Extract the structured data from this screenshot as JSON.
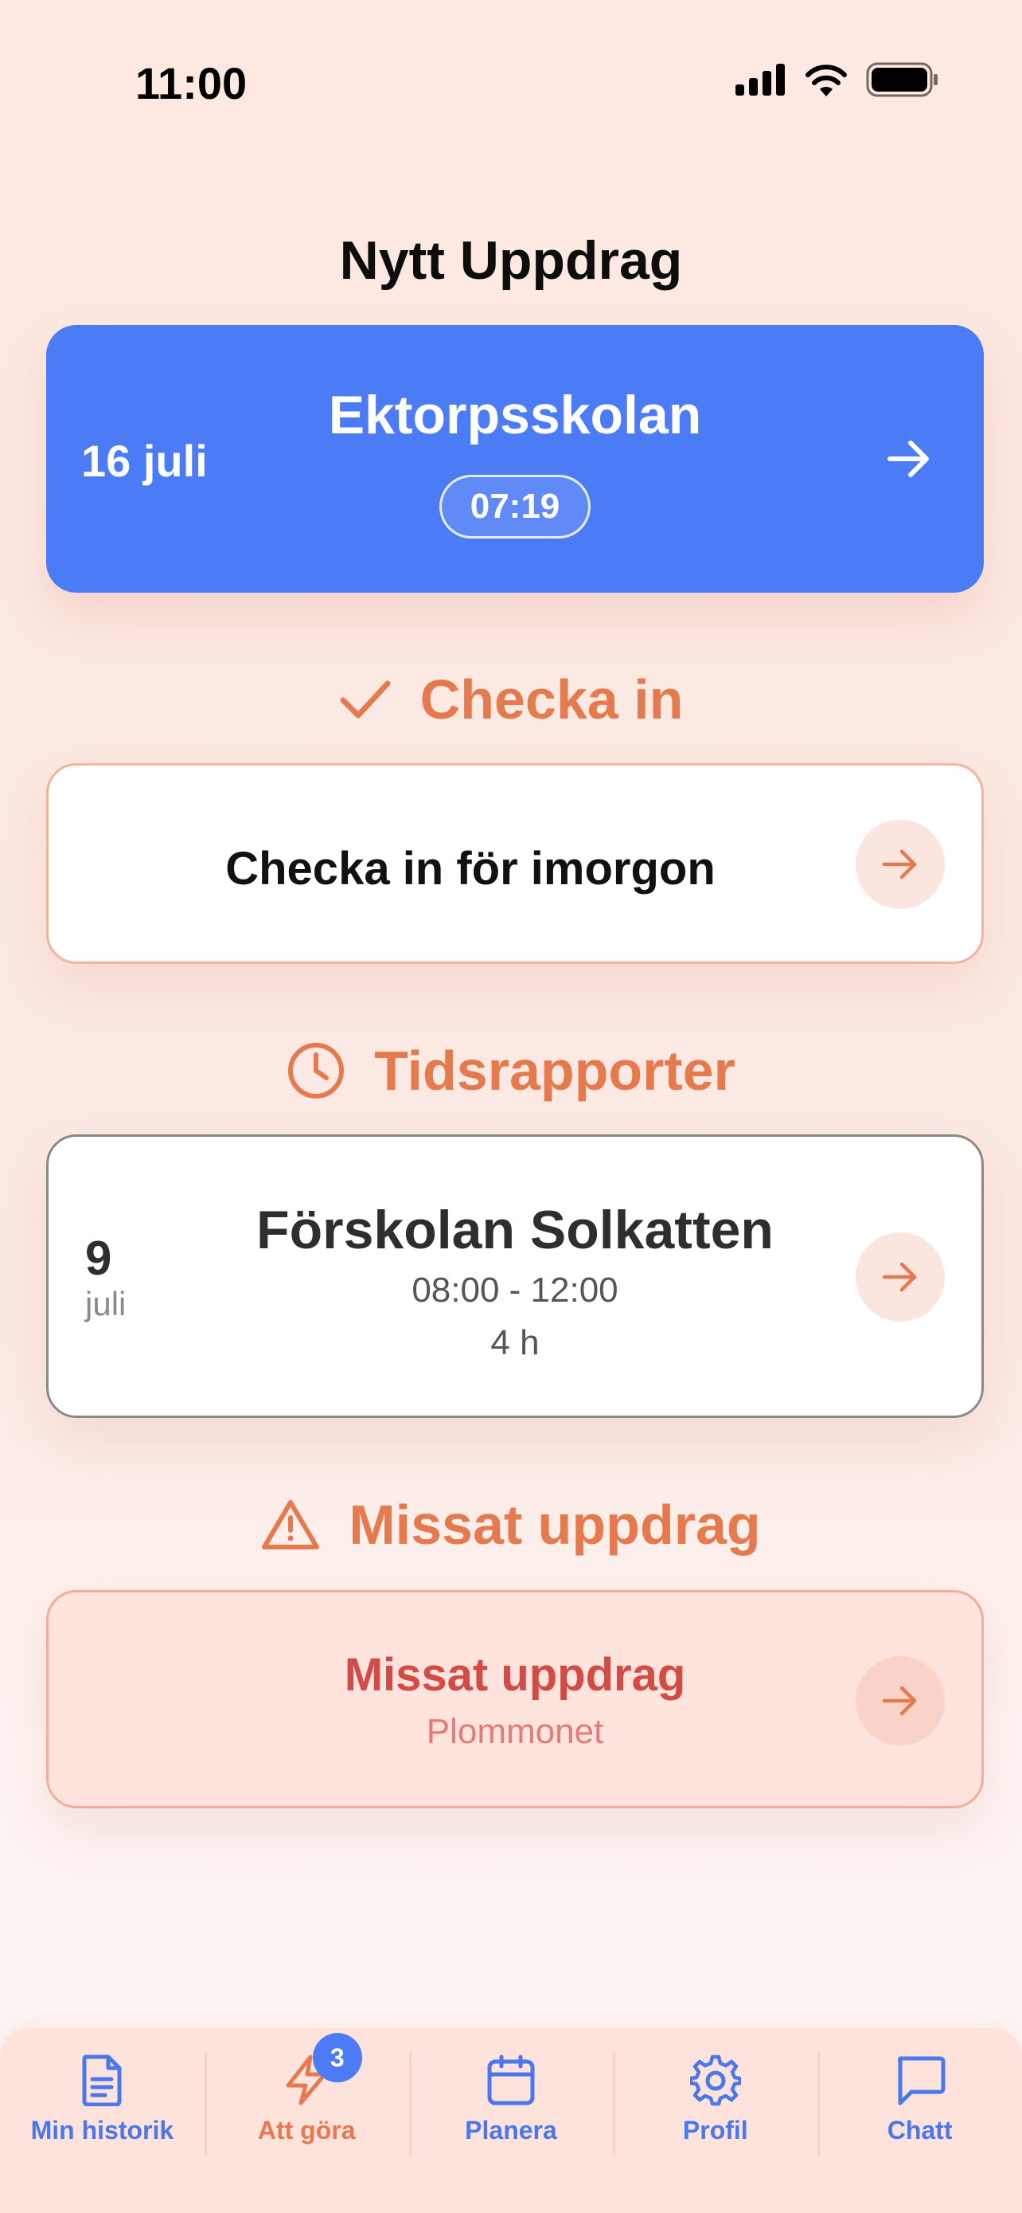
{
  "status_bar": {
    "time": "11:00"
  },
  "header": {
    "title": "Nytt Uppdrag"
  },
  "new_assignment": {
    "date": "16 juli",
    "school": "Ektorpsskolan",
    "time": "07:19"
  },
  "checkin": {
    "section_title": "Checka in",
    "card_label": "Checka in för imorgon"
  },
  "timereports": {
    "section_title": "Tidsrapporter",
    "item": {
      "day": "9",
      "month": "juli",
      "place": "Förskolan Solkatten",
      "times": "08:00 - 12:00",
      "hours": "4 h"
    }
  },
  "missed": {
    "section_title": "Missat uppdrag",
    "card_title": "Missat uppdrag",
    "card_subtitle": "Plommonet"
  },
  "tabbar": {
    "items": [
      {
        "label": "Min historik",
        "icon": "document-icon"
      },
      {
        "label": "Att göra",
        "icon": "lightning-icon",
        "badge": "3"
      },
      {
        "label": "Planera",
        "icon": "calendar-icon"
      },
      {
        "label": "Profil",
        "icon": "gear-icon"
      },
      {
        "label": "Chatt",
        "icon": "chat-bubble-icon"
      }
    ]
  },
  "colors": {
    "primary_blue": "#4b7bf5",
    "accent_orange": "#e57a4e",
    "missed_red": "#d24b45",
    "background": "#fde9e2"
  }
}
